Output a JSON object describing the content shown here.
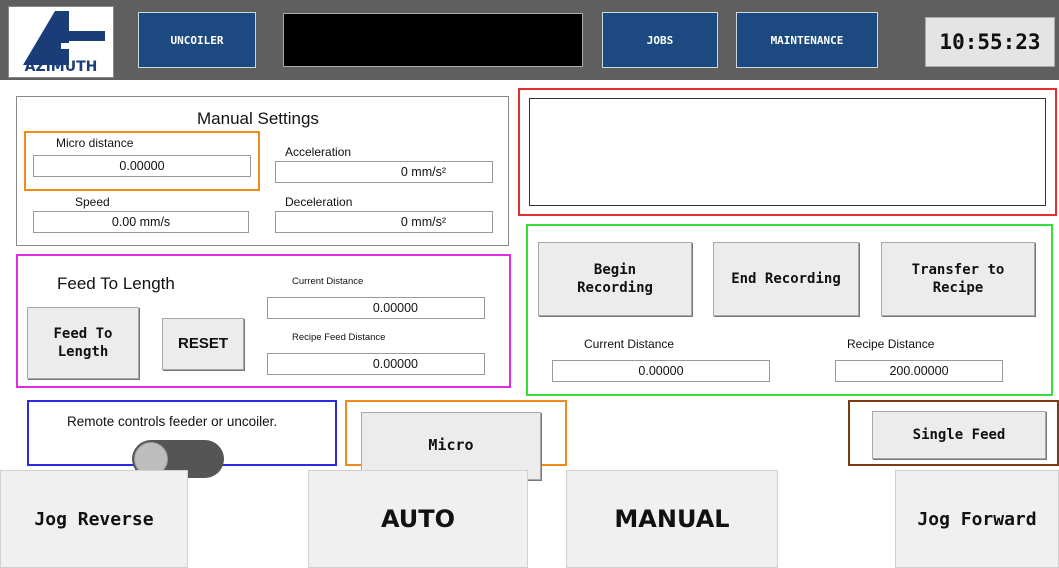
{
  "header": {
    "logo_text": "AZIMUTH",
    "uncoiler_label": "UNCOILER",
    "jobs_label": "JOBS",
    "maintenance_label": "MAINTENANCE",
    "clock": "10:55:23",
    "status_message": ""
  },
  "manual_settings": {
    "title": "Manual Settings",
    "micro_distance_label": "Micro distance",
    "micro_distance_value": "0.00000",
    "speed_label": "Speed",
    "speed_value": "0.00 mm/s",
    "acceleration_label": "Acceleration",
    "acceleration_value": "0 mm/s²",
    "deceleration_label": "Deceleration",
    "deceleration_value": "0 mm/s²"
  },
  "message_box": {
    "text": ""
  },
  "feed_to_length": {
    "title": "Feed To Length",
    "feed_button": "Feed To\nLength",
    "reset_button": "RESET",
    "current_distance_label": "Current Distance",
    "current_distance_value": "0.00000",
    "recipe_feed_distance_label": "Recipe Feed Distance",
    "recipe_feed_distance_value": "0.00000"
  },
  "recording": {
    "begin_button": "Begin\nRecording",
    "end_button": "End Recording",
    "transfer_button": "Transfer to\nRecipe",
    "current_distance_label": "Current Distance",
    "current_distance_value": "0.00000",
    "recipe_distance_label": "Recipe Distance",
    "recipe_distance_value": "200.00000"
  },
  "remote": {
    "label": "Remote controls feeder or uncoiler.",
    "toggle_on": false
  },
  "micro_button": "Micro",
  "single_feed_button": "Single Feed",
  "bottom": {
    "jog_reverse": "Jog Reverse",
    "auto": "AUTO",
    "manual": "MANUAL",
    "jog_forward": "Jog Forward"
  },
  "colors": {
    "header_bg": "#5f5f5f",
    "nav_button": "#1c4a80",
    "logo": "#1a3d78",
    "manual_micro_frame": "#f08a1c",
    "message_frame": "#e23030",
    "feed_to_length_frame": "#e02ce0",
    "recording_frame": "#36e036",
    "remote_frame": "#2b2bdc",
    "micro_frame": "#f08a1c",
    "single_feed_frame": "#7a3b12"
  }
}
